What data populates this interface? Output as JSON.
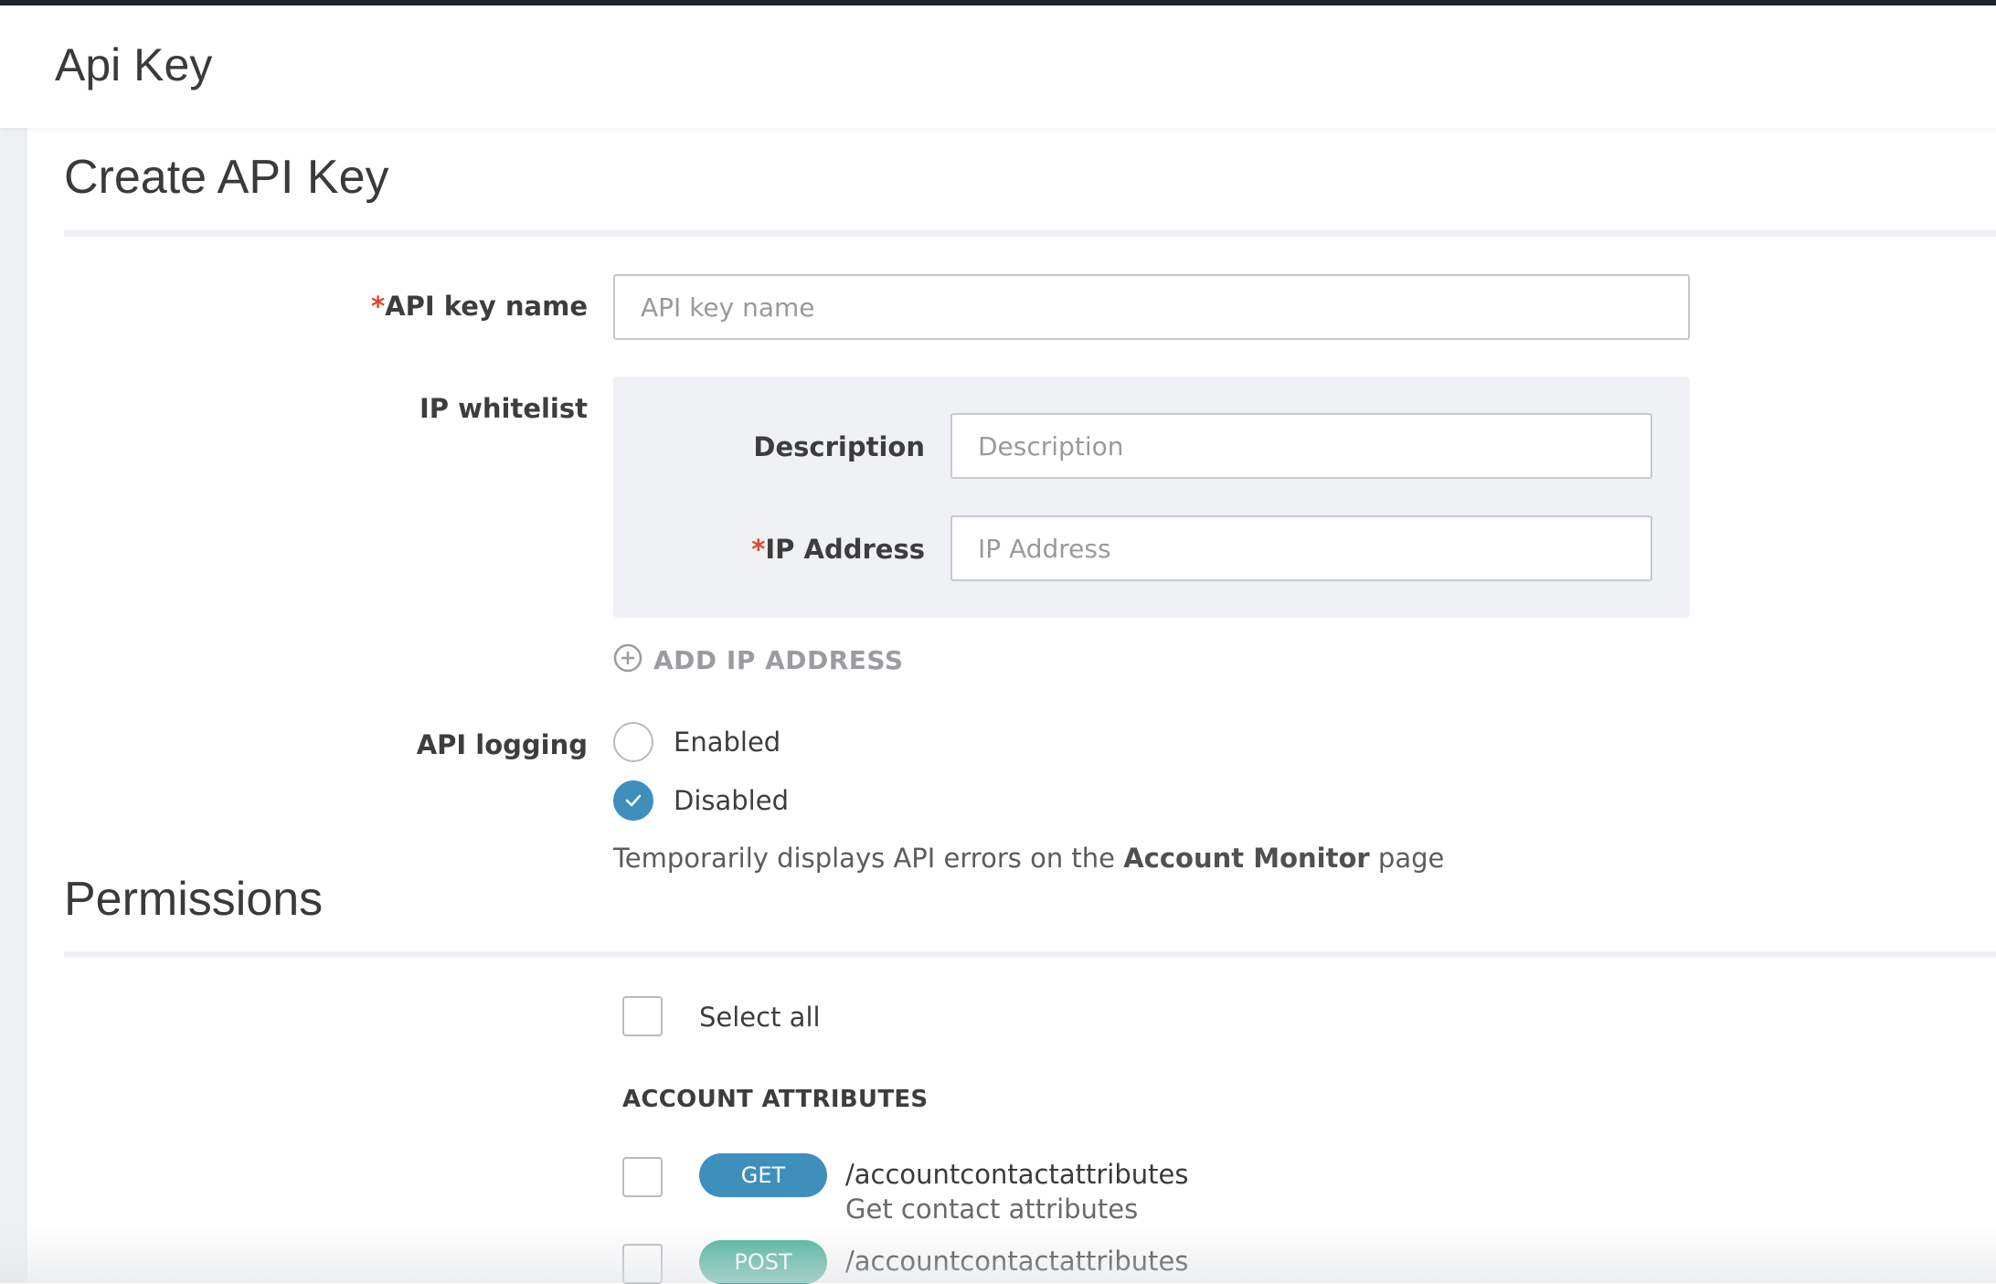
{
  "header": {
    "title": "Api Key"
  },
  "create_section": {
    "title": "Create API Key"
  },
  "form": {
    "api_key_name": {
      "required_mark": "*",
      "label": "API key name",
      "placeholder": "API key name",
      "value": ""
    },
    "ip_whitelist": {
      "label": "IP whitelist",
      "description": {
        "label": "Description",
        "placeholder": "Description",
        "value": ""
      },
      "ip_address": {
        "required_mark": "*",
        "label": "IP Address",
        "placeholder": "IP Address",
        "value": ""
      },
      "add_button": "ADD IP ADDRESS"
    },
    "api_logging": {
      "label": "API logging",
      "options": [
        {
          "label": "Enabled",
          "selected": false
        },
        {
          "label": "Disabled",
          "selected": true
        }
      ],
      "help_prefix": "Temporarily displays API errors on the ",
      "help_link": "Account Monitor",
      "help_suffix": " page"
    }
  },
  "permissions": {
    "title": "Permissions",
    "select_all_label": "Select all",
    "group_title": "ACCOUNT ATTRIBUTES",
    "endpoints": [
      {
        "method": "GET",
        "method_color": "#3f8fbd",
        "path": "/accountcontactattributes",
        "description": "Get contact attributes"
      },
      {
        "method": "POST",
        "method_color": "#4db39a",
        "path": "/accountcontactattributes",
        "description": ""
      }
    ]
  }
}
